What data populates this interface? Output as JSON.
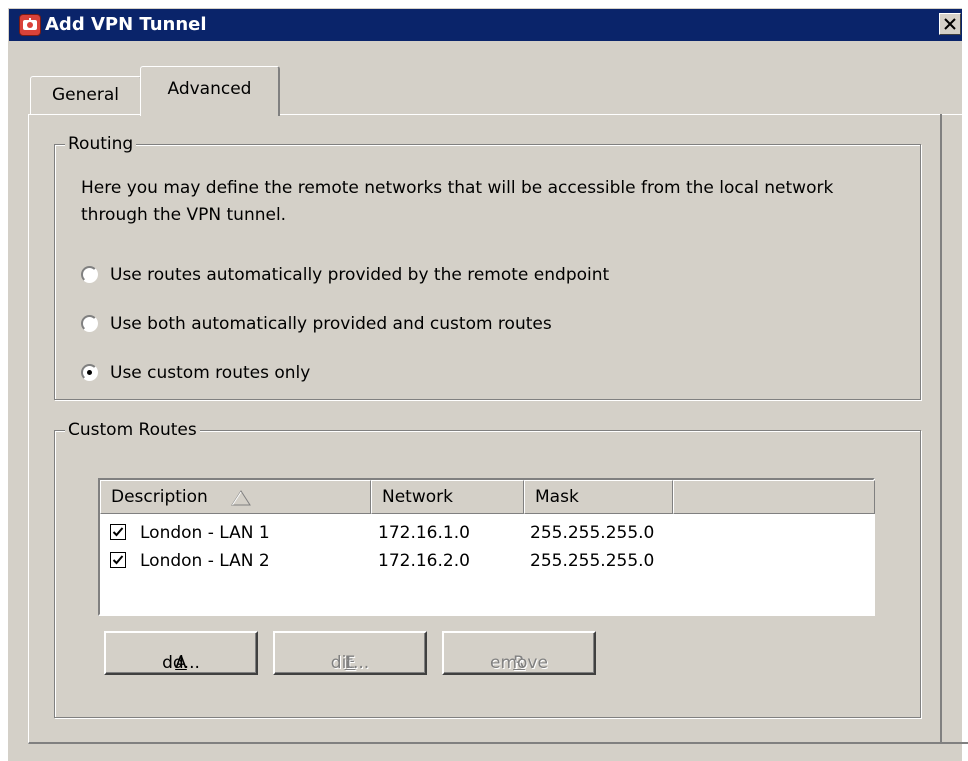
{
  "window": {
    "title": "Add VPN Tunnel",
    "close_glyph": "close-icon"
  },
  "tabs": [
    {
      "label": "General",
      "active": false
    },
    {
      "label": "Advanced",
      "active": true
    }
  ],
  "routing": {
    "legend": "Routing",
    "description": "Here you may define the remote networks that will be accessible from the local network\nthrough the VPN tunnel.",
    "options": [
      {
        "label": "Use routes automatically provided by the remote endpoint",
        "selected": false
      },
      {
        "label": "Use both automatically provided and custom routes",
        "selected": false
      },
      {
        "label": "Use custom routes only",
        "selected": true
      }
    ]
  },
  "custom_routes": {
    "legend": "Custom Routes",
    "columns": [
      "Description",
      "Network",
      "Mask",
      ""
    ],
    "sort_column": "Description",
    "rows": [
      {
        "checked": true,
        "description": "London - LAN 1",
        "network": "172.16.1.0",
        "mask": "255.255.255.0"
      },
      {
        "checked": true,
        "description": "London - LAN 2",
        "network": "172.16.2.0",
        "mask": "255.255.255.0"
      }
    ],
    "buttons": {
      "add": {
        "mnemonic": "A",
        "rest": "dd...",
        "enabled": true
      },
      "edit": {
        "mnemonic": "E",
        "rest": "dit...",
        "enabled": false
      },
      "remove": {
        "mnemonic": "R",
        "rest": "emove",
        "enabled": false
      }
    }
  },
  "colors": {
    "titlebar": "#0a246a",
    "face": "#d4d0c8",
    "disabled_text": "#808080"
  }
}
